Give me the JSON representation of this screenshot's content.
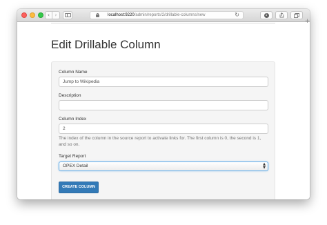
{
  "browser": {
    "url_host": "localhost:9220",
    "url_path": "/admin/reports/2/drillable-columns/new"
  },
  "icons": {
    "back": "chevron-left-icon",
    "forward": "chevron-right-icon",
    "sidebar": "sidebar-icon",
    "lock": "lock-icon",
    "reload": "reload-icon",
    "download": "download-icon",
    "share": "share-icon",
    "tabs": "tabs-icon",
    "new_tab": "plus-icon"
  },
  "page": {
    "title": "Edit Drillable Column"
  },
  "form": {
    "column_name": {
      "label": "Column Name",
      "value": "Jump to Wikipedia"
    },
    "description": {
      "label": "Description",
      "value": ""
    },
    "column_index": {
      "label": "Column Index",
      "value": "2",
      "help": "The index of the column in the source report to activate links for. The first column is 0, the second is 1, and so on."
    },
    "target_report": {
      "label": "Target Report",
      "selected": "OPEX Detail"
    },
    "submit_label": "CREATE COLUMN"
  },
  "colors": {
    "primary_button": "#337ab7",
    "focus_border": "#66afe9",
    "panel_bg": "#f5f5f5"
  }
}
